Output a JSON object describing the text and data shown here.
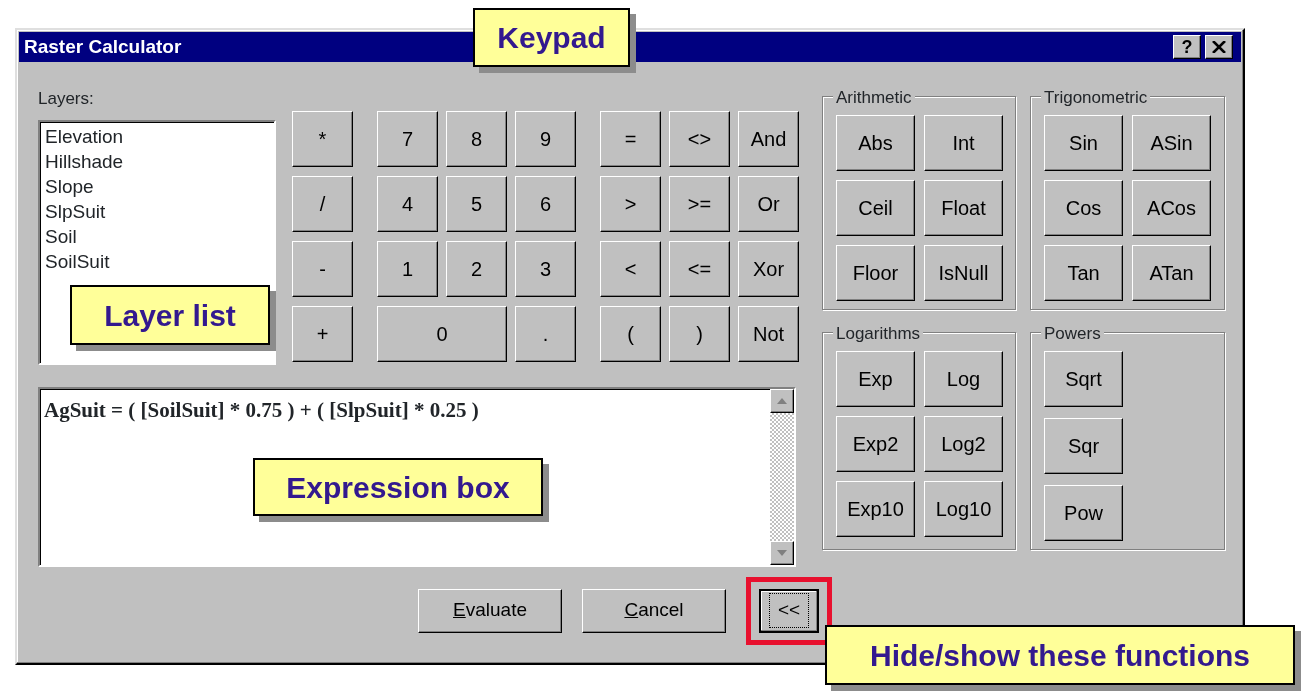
{
  "window": {
    "title": "Raster Calculator",
    "help_button": "?"
  },
  "layers": {
    "label": "Layers:",
    "items": [
      "Elevation",
      "Hillshade",
      "Slope",
      "SlpSuit",
      "Soil",
      "SoilSuit"
    ]
  },
  "keypad": {
    "groups": [
      [
        {
          "label": "*",
          "kind": "normal"
        },
        {
          "label": "/",
          "kind": "normal"
        },
        {
          "label": "-",
          "kind": "normal"
        },
        {
          "label": "+",
          "kind": "normal"
        }
      ],
      [
        {
          "label": "7",
          "kind": "normal"
        },
        {
          "label": "8",
          "kind": "normal"
        },
        {
          "label": "9",
          "kind": "normal"
        },
        {
          "label": "4",
          "kind": "normal"
        },
        {
          "label": "5",
          "kind": "normal"
        },
        {
          "label": "6",
          "kind": "normal"
        },
        {
          "label": "1",
          "kind": "normal"
        },
        {
          "label": "2",
          "kind": "normal"
        },
        {
          "label": "3",
          "kind": "normal"
        },
        {
          "label": "0",
          "kind": "wide"
        },
        {
          "label": ".",
          "kind": "normal"
        }
      ],
      [
        {
          "label": "=",
          "kind": "normal"
        },
        {
          "label": "<>",
          "kind": "normal"
        },
        {
          "label": "And",
          "kind": "normal"
        },
        {
          "label": ">",
          "kind": "normal"
        },
        {
          "label": ">=",
          "kind": "normal"
        },
        {
          "label": "Or",
          "kind": "normal"
        },
        {
          "label": "<",
          "kind": "normal"
        },
        {
          "label": "<=",
          "kind": "normal"
        },
        {
          "label": "Xor",
          "kind": "normal"
        },
        {
          "label": "(",
          "kind": "normal"
        },
        {
          "label": ")",
          "kind": "normal"
        },
        {
          "label": "Not",
          "kind": "normal"
        }
      ]
    ]
  },
  "expression": {
    "value": "AgSuit = ( [SoilSuit] * 0.75 ) + ( [SlpSuit] * 0.25 )"
  },
  "function_groups": [
    {
      "title": "Arithmetic",
      "buttons": [
        "Abs",
        "Int",
        "Ceil",
        "Float",
        "Floor",
        "IsNull"
      ]
    },
    {
      "title": "Trigonometric",
      "buttons": [
        "Sin",
        "ASin",
        "Cos",
        "ACos",
        "Tan",
        "ATan"
      ]
    },
    {
      "title": "Logarithms",
      "buttons": [
        "Exp",
        "Log",
        "Exp2",
        "Log2",
        "Exp10",
        "Log10"
      ]
    },
    {
      "title": "Powers",
      "buttons": [
        "Sqrt",
        "Sqr",
        "Pow"
      ]
    }
  ],
  "buttons": [
    {
      "label": "Evaluate",
      "mnemonic": true,
      "focused": false,
      "highlighted": false
    },
    {
      "label": "Cancel",
      "mnemonic": true,
      "focused": false,
      "highlighted": false
    },
    {
      "label": "<<",
      "mnemonic": false,
      "focused": true,
      "highlighted": true
    }
  ],
  "callouts": [
    {
      "text": "Keypad"
    },
    {
      "text": "Layer list"
    },
    {
      "text": "Expression box"
    },
    {
      "text": "Hide/show these functions"
    }
  ]
}
